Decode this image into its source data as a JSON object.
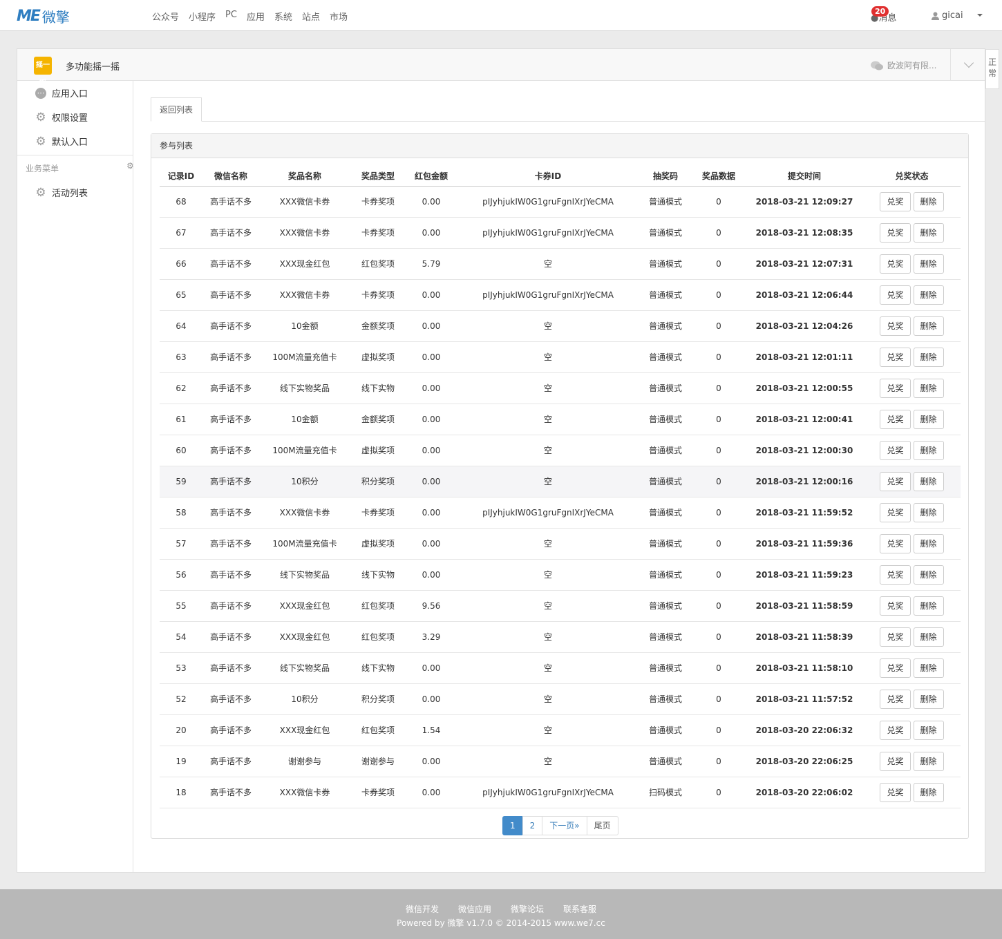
{
  "brand": {
    "mark": "ME",
    "name": "微擎"
  },
  "topnav": [
    "公众号",
    "小程序",
    "PC",
    "应用",
    "系统",
    "站点",
    "市场"
  ],
  "header": {
    "messages_label": "消息",
    "messages_count": "20",
    "user": "gicai"
  },
  "side_tab": "正常",
  "app": {
    "icon_text": "摇一摇",
    "title": "多功能摇一摇",
    "account": "欧波阿有限..."
  },
  "sidebar": {
    "items": [
      {
        "label": "应用入口",
        "icon": "chat-icon"
      },
      {
        "label": "权限设置",
        "icon": "gear-icon"
      },
      {
        "label": "默认入口",
        "icon": "gear-icon"
      }
    ],
    "group_title": "业务菜单",
    "group_items": [
      {
        "label": "活动列表",
        "icon": "gear-icon"
      }
    ]
  },
  "tab_label": "返回列表",
  "panel_title": "参与列表",
  "table": {
    "columns": [
      "记录ID",
      "微信名称",
      "奖品名称",
      "奖品类型",
      "红包金额",
      "卡券ID",
      "抽奖码",
      "奖品数据",
      "提交时间",
      "兑奖状态"
    ],
    "rows": [
      [
        "68",
        "高手话不多",
        "XXX微信卡券",
        "卡券奖项",
        "0.00",
        "pIJyhjukIW0G1gruFgnIXrJYeCMA",
        "普通模式",
        "0",
        "2018-03-21 12:09:27"
      ],
      [
        "67",
        "高手话不多",
        "XXX微信卡券",
        "卡券奖项",
        "0.00",
        "pIJyhjukIW0G1gruFgnIXrJYeCMA",
        "普通模式",
        "0",
        "2018-03-21 12:08:35"
      ],
      [
        "66",
        "高手话不多",
        "XXX现金红包",
        "红包奖项",
        "5.79",
        "空",
        "普通模式",
        "0",
        "2018-03-21 12:07:31"
      ],
      [
        "65",
        "高手话不多",
        "XXX微信卡券",
        "卡券奖项",
        "0.00",
        "pIJyhjukIW0G1gruFgnIXrJYeCMA",
        "普通模式",
        "0",
        "2018-03-21 12:06:44"
      ],
      [
        "64",
        "高手话不多",
        "10金额",
        "金额奖项",
        "0.00",
        "空",
        "普通模式",
        "0",
        "2018-03-21 12:04:26"
      ],
      [
        "63",
        "高手话不多",
        "100M流量充值卡",
        "虚拟奖项",
        "0.00",
        "空",
        "普通模式",
        "0",
        "2018-03-21 12:01:11"
      ],
      [
        "62",
        "高手话不多",
        "线下实物奖品",
        "线下实物",
        "0.00",
        "空",
        "普通模式",
        "0",
        "2018-03-21 12:00:55"
      ],
      [
        "61",
        "高手话不多",
        "10金额",
        "金额奖项",
        "0.00",
        "空",
        "普通模式",
        "0",
        "2018-03-21 12:00:41"
      ],
      [
        "60",
        "高手话不多",
        "100M流量充值卡",
        "虚拟奖项",
        "0.00",
        "空",
        "普通模式",
        "0",
        "2018-03-21 12:00:30"
      ],
      [
        "59",
        "高手话不多",
        "10积分",
        "积分奖项",
        "0.00",
        "空",
        "普通模式",
        "0",
        "2018-03-21 12:00:16"
      ],
      [
        "58",
        "高手话不多",
        "XXX微信卡券",
        "卡券奖项",
        "0.00",
        "pIJyhjukIW0G1gruFgnIXrJYeCMA",
        "普通模式",
        "0",
        "2018-03-21 11:59:52"
      ],
      [
        "57",
        "高手话不多",
        "100M流量充值卡",
        "虚拟奖项",
        "0.00",
        "空",
        "普通模式",
        "0",
        "2018-03-21 11:59:36"
      ],
      [
        "56",
        "高手话不多",
        "线下实物奖品",
        "线下实物",
        "0.00",
        "空",
        "普通模式",
        "0",
        "2018-03-21 11:59:23"
      ],
      [
        "55",
        "高手话不多",
        "XXX现金红包",
        "红包奖项",
        "9.56",
        "空",
        "普通模式",
        "0",
        "2018-03-21 11:58:59"
      ],
      [
        "54",
        "高手话不多",
        "XXX现金红包",
        "红包奖项",
        "3.29",
        "空",
        "普通模式",
        "0",
        "2018-03-21 11:58:39"
      ],
      [
        "53",
        "高手话不多",
        "线下实物奖品",
        "线下实物",
        "0.00",
        "空",
        "普通模式",
        "0",
        "2018-03-21 11:58:10"
      ],
      [
        "52",
        "高手话不多",
        "10积分",
        "积分奖项",
        "0.00",
        "空",
        "普通模式",
        "0",
        "2018-03-21 11:57:52"
      ],
      [
        "20",
        "高手话不多",
        "XXX现金红包",
        "红包奖项",
        "1.54",
        "空",
        "普通模式",
        "0",
        "2018-03-20 22:06:32"
      ],
      [
        "19",
        "高手话不多",
        "谢谢参与",
        "谢谢参与",
        "0.00",
        "空",
        "普通模式",
        "0",
        "2018-03-20 22:06:25"
      ],
      [
        "18",
        "高手话不多",
        "XXX微信卡券",
        "卡券奖项",
        "0.00",
        "pIJyhjukIW0G1gruFgnIXrJYeCMA",
        "扫码模式",
        "0",
        "2018-03-20 22:06:02"
      ]
    ],
    "highlighted_row_id": "59",
    "action_labels": {
      "redeem": "兑奖",
      "delete": "删除"
    }
  },
  "pagination": {
    "pages": [
      "1",
      "2"
    ],
    "current": "1",
    "next": "下一页»",
    "last": "尾页"
  },
  "footer": {
    "links": [
      "微信开发",
      "微信应用",
      "微擎论坛",
      "联系客服"
    ],
    "copyright": "Powered by 微擎 v1.7.0 © 2014-2015 www.we7.cc"
  },
  "colors": {
    "brand": "#2f7ec1",
    "badge": "#e02f2f",
    "accent": "#428bca",
    "app_icon": "#f5b400"
  }
}
